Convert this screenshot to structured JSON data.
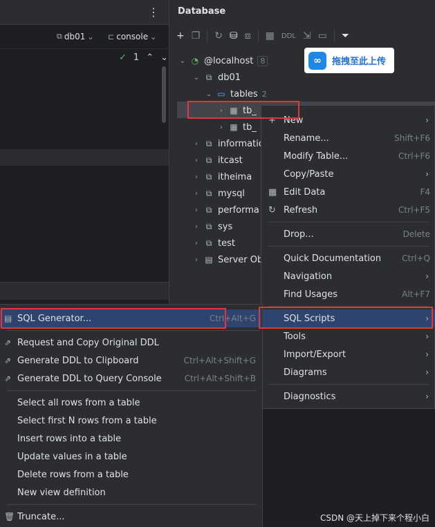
{
  "editor": {
    "kebab": "⋮",
    "db_pill": "db01",
    "console_pill": "console",
    "inspection_count": "1"
  },
  "db_panel": {
    "title": "Database",
    "ddl": "DDL",
    "tree": [
      {
        "label": "@localhost",
        "count": "8"
      },
      {
        "label": "db01"
      },
      {
        "label": "tables",
        "count": "2"
      },
      {
        "label": "tb_"
      },
      {
        "label": "tb_"
      },
      {
        "label": "informatio"
      },
      {
        "label": "itcast"
      },
      {
        "label": "itheima"
      },
      {
        "label": "mysql"
      },
      {
        "label": "performa"
      },
      {
        "label": "sys"
      },
      {
        "label": "test"
      },
      {
        "label": "Server Ob"
      }
    ]
  },
  "upload_badge": {
    "text": "拖拽至此上传"
  },
  "context_menu": {
    "items": [
      {
        "label": "New",
        "shortcut": ""
      },
      {
        "label": "Rename...",
        "shortcut": "Shift+F6"
      },
      {
        "label": "Modify Table...",
        "shortcut": "Ctrl+F6"
      },
      {
        "label": "Copy/Paste",
        "shortcut": ""
      },
      {
        "label": "Edit Data",
        "shortcut": "F4"
      },
      {
        "label": "Refresh",
        "shortcut": "Ctrl+F5"
      },
      {
        "label": "Drop...",
        "shortcut": "Delete"
      },
      {
        "label": "Quick Documentation",
        "shortcut": "Ctrl+Q"
      },
      {
        "label": "Navigation",
        "shortcut": ""
      },
      {
        "label": "Find Usages",
        "shortcut": "Alt+F7"
      },
      {
        "label": "SQL Scripts",
        "shortcut": ""
      },
      {
        "label": "Tools",
        "shortcut": ""
      },
      {
        "label": "Import/Export",
        "shortcut": ""
      },
      {
        "label": "Diagrams",
        "shortcut": ""
      },
      {
        "label": "Diagnostics",
        "shortcut": ""
      }
    ]
  },
  "sql_submenu": {
    "items": [
      {
        "label": "SQL Generator...",
        "shortcut": "Ctrl+Alt+G"
      },
      {
        "label": "Request and Copy Original DDL",
        "shortcut": ""
      },
      {
        "label": "Generate DDL to Clipboard",
        "shortcut": "Ctrl+Alt+Shift+G"
      },
      {
        "label": "Generate DDL to Query Console",
        "shortcut": "Ctrl+Alt+Shift+B"
      },
      {
        "label": "Select all rows from a table",
        "shortcut": ""
      },
      {
        "label": "Select first N rows from a table",
        "shortcut": ""
      },
      {
        "label": "Insert rows into a table",
        "shortcut": ""
      },
      {
        "label": "Update values in a table",
        "shortcut": ""
      },
      {
        "label": "Delete rows from a table",
        "shortcut": ""
      },
      {
        "label": "New view definition",
        "shortcut": ""
      },
      {
        "label": "Truncate...",
        "shortcut": ""
      }
    ]
  },
  "watermark": "CSDN @天上掉下来个程小白",
  "colors": {
    "highlight": "#2e436e",
    "annotation_red": "#e5343a",
    "background": "#2b2d30"
  }
}
